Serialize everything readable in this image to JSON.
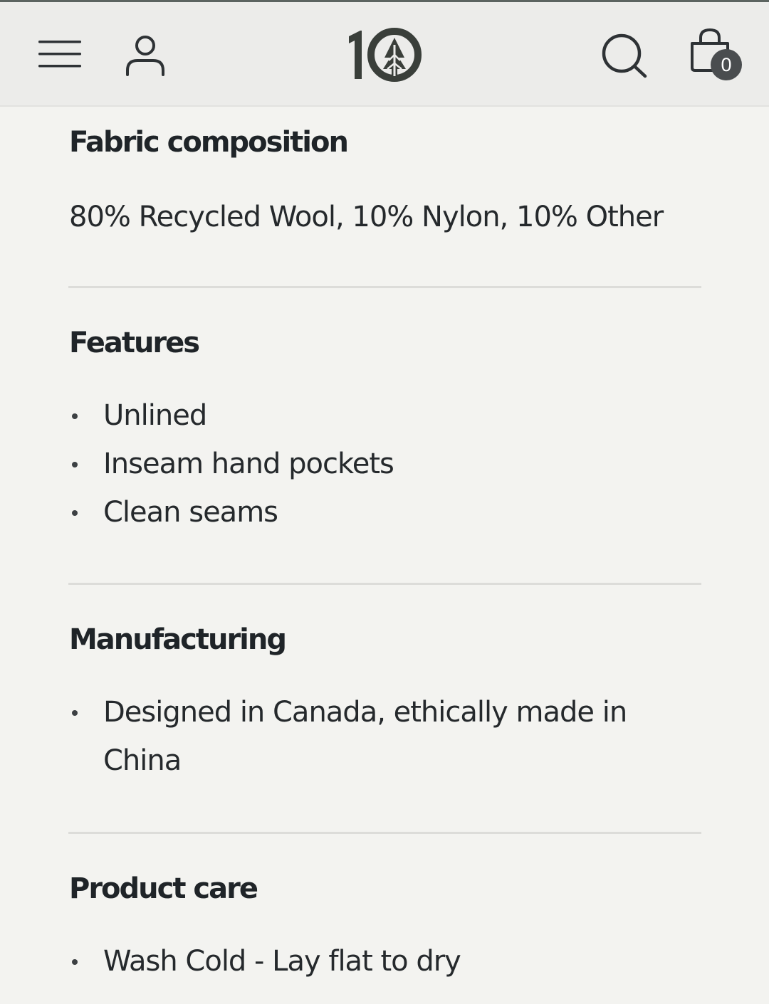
{
  "header": {
    "menu_icon": "hamburger-menu-icon",
    "account_icon": "user-icon",
    "logo_text": "10",
    "search_icon": "search-icon",
    "cart_icon": "shopping-bag-icon",
    "cart_count": "0"
  },
  "sections": [
    {
      "title": "Fabric composition",
      "text": "80% Recycled Wool, 10% Nylon, 10% Other"
    },
    {
      "title": "Features",
      "items": [
        "Unlined",
        "Inseam hand pockets",
        "Clean seams"
      ]
    },
    {
      "title": "Manufacturing",
      "items": [
        "Designed in Canada, ethically made in China"
      ]
    },
    {
      "title": "Product care",
      "items": [
        "Wash Cold - Lay flat to dry"
      ]
    }
  ]
}
